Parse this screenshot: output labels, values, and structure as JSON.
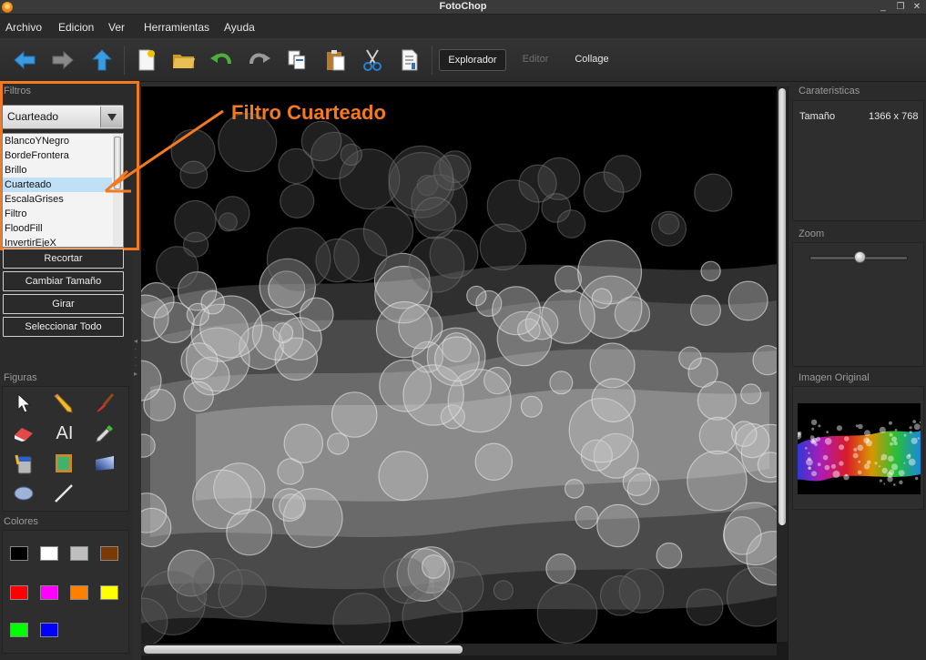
{
  "window": {
    "title": "FotoChop",
    "minimize": "_",
    "restore": "❐",
    "close": "✕"
  },
  "menu": [
    "Archivo",
    "Edicion",
    "Ver",
    "Herramientas",
    "Ayuda"
  ],
  "toolbar": {
    "icons": [
      "back-arrow-icon",
      "forward-arrow-icon",
      "up-arrow-icon",
      "new-file-icon",
      "open-folder-icon",
      "undo-icon",
      "redo-icon",
      "copy-icon",
      "paste-icon",
      "cut-icon",
      "properties-icon"
    ],
    "modes": [
      "Explorador",
      "Editor",
      "Collage"
    ],
    "active_mode": "Explorador"
  },
  "filters": {
    "header": "Filtros",
    "selected": "Cuarteado",
    "items": [
      "BlancoYNegro",
      "BordeFrontera",
      "Brillo",
      "Cuarteado",
      "EscalaGrises",
      "Filtro",
      "FloodFill",
      "InvertirEjeX"
    ],
    "actions": [
      "Recortar",
      "Cambiar Tamaño",
      "Girar",
      "Seleccionar Todo"
    ]
  },
  "annotation": {
    "text": "Filtro Cuarteado",
    "color": "#f47a20"
  },
  "figuras": {
    "header": "Figuras",
    "tools": [
      "pointer-icon",
      "pencil-icon",
      "brush-icon",
      "eraser-icon",
      "text-tool-icon",
      "eyedropper-icon",
      "paint-bucket-icon",
      "frame-icon",
      "gradient-icon",
      "ellipse-icon",
      "line-icon"
    ],
    "text_tool_label": "AI"
  },
  "colores": {
    "header": "Colores",
    "swatches": [
      "#000000",
      "#ffffff",
      "#bfbfbf",
      "#7a3a08",
      "#ff0000",
      "#ff00ff",
      "#ff8000",
      "#ffff00",
      "#00ff00",
      "#0000ff"
    ]
  },
  "right": {
    "caracteristicas_header": "Carateristicas",
    "size_label": "Tamaño",
    "size_value": "1366 x 768",
    "zoom_header": "Zoom",
    "zoom_level": 0.52,
    "original_header": "Imagen Original"
  }
}
